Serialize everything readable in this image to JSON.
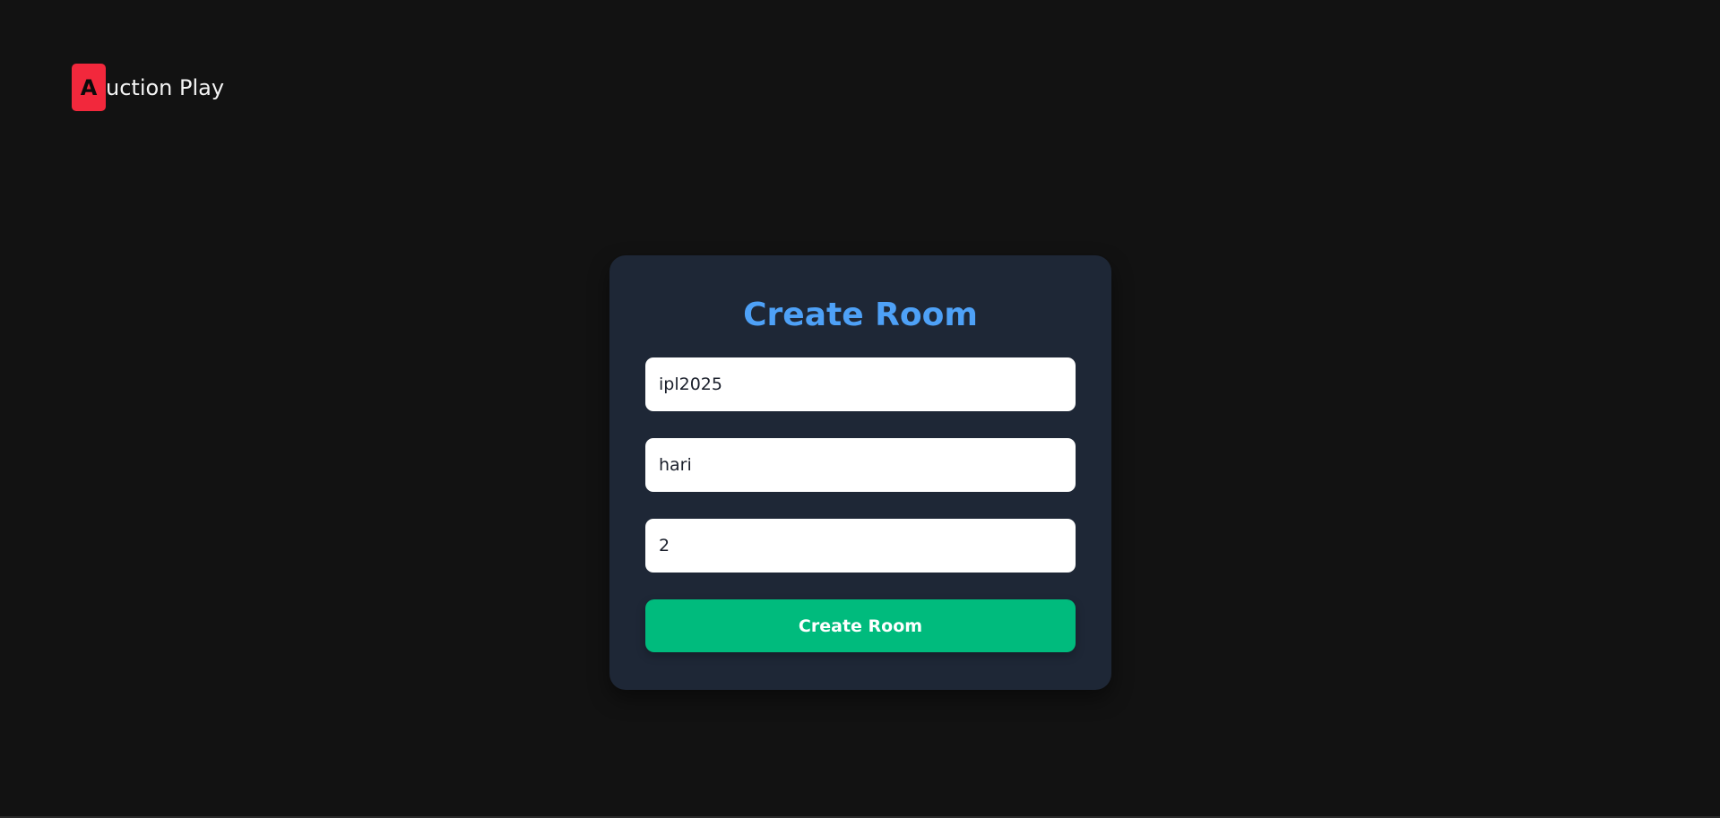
{
  "app": {
    "logo_letter": "A",
    "logo_text": "uction Play"
  },
  "form": {
    "title": "Create Room",
    "fields": [
      {
        "name": "room-id",
        "value": "ipl2025",
        "placeholder": ""
      },
      {
        "name": "user-name",
        "value": "hari",
        "placeholder": ""
      },
      {
        "name": "team-count",
        "value": "2",
        "placeholder": ""
      }
    ],
    "submit_label": "Create Room"
  },
  "colors": {
    "background": "#121212",
    "card": "#1e2736",
    "title": "#4ea1f7",
    "logo_accent": "#f2283c",
    "submit": "#00bb7d"
  }
}
